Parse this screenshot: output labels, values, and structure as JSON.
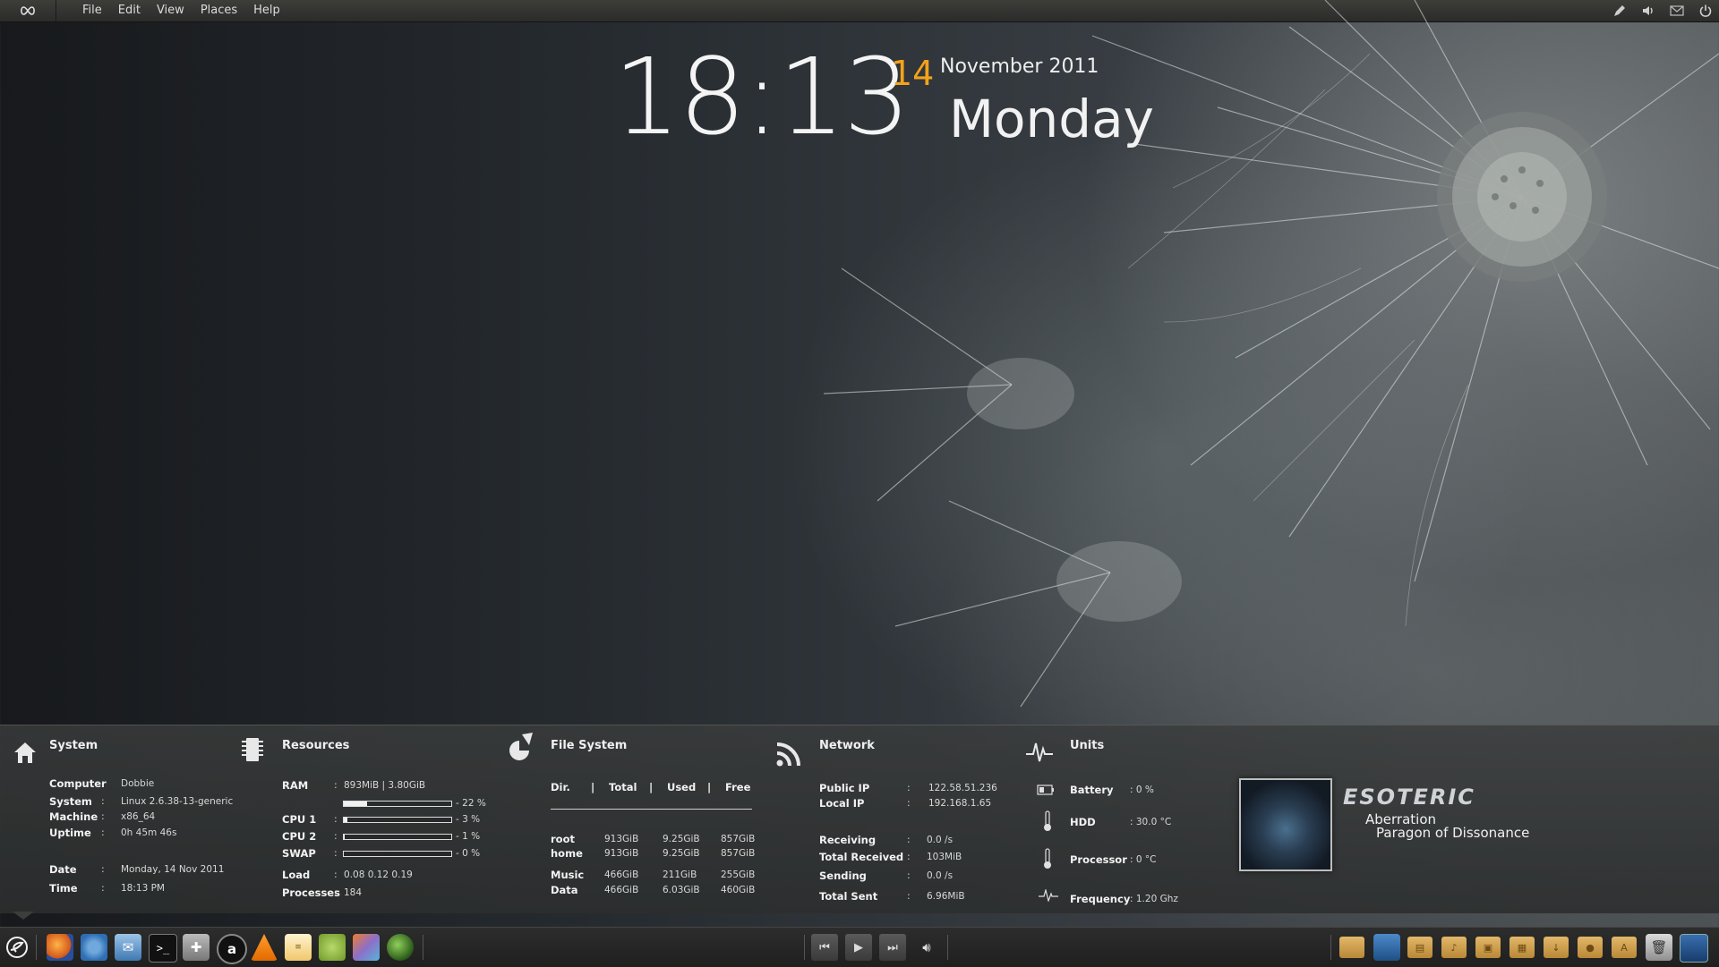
{
  "top_panel": {
    "logo_icon": "infinity-icon",
    "menu": [
      "File",
      "Edit",
      "View",
      "Places",
      "Help"
    ],
    "tray_icons": [
      "pen-icon",
      "volume-icon",
      "mail-icon",
      "power-icon"
    ]
  },
  "clock": {
    "time": "18:13",
    "day": "14",
    "month_year": "November 2011",
    "weekday": "Monday",
    "accent_color": "#f3a21b"
  },
  "conky": {
    "system": {
      "title": "System",
      "icon": "home-icon",
      "rows": [
        {
          "label": "Computer",
          "sep": ":",
          "value": "Dobbie"
        },
        {
          "label": "System",
          "sep": ":",
          "value": "Linux  2.6.38-13-generic"
        },
        {
          "label": "Machine",
          "sep": ":",
          "value": "x86_64"
        },
        {
          "label": "Uptime",
          "sep": ":",
          "value": "0h 45m 46s"
        },
        {
          "label": "Date",
          "sep": ":",
          "value": "Monday, 14 Nov 2011"
        },
        {
          "label": "Time",
          "sep": ":",
          "value": "18:13 PM"
        }
      ]
    },
    "resources": {
      "title": "Resources",
      "icon": "chip-icon",
      "ram_label": "RAM",
      "ram_value": "893MiB  |  3.80GiB",
      "ram_percent": "22 %",
      "ram_fraction": 0.22,
      "cpus": [
        {
          "label": "CPU 1",
          "percent": "3 %",
          "fraction": 0.03
        },
        {
          "label": "CPU 2",
          "percent": "1 %",
          "fraction": 0.01
        },
        {
          "label": "SWAP",
          "percent": "0 %",
          "fraction": 0.0
        }
      ],
      "load_label": "Load",
      "load_value": "0.08 0.12 0.19",
      "processes_label": "Processes",
      "processes_value": "184"
    },
    "filesystem": {
      "title": "File System",
      "icon": "pie-chart-icon",
      "headers": [
        "Dir.",
        "|",
        "Total",
        "|",
        "Used",
        "|",
        "Free"
      ],
      "rows": [
        {
          "dir": "root",
          "total": "913GiB",
          "used": "9.25GiB",
          "free": "857GiB"
        },
        {
          "dir": "home",
          "total": "913GiB",
          "used": "9.25GiB",
          "free": "857GiB"
        },
        {
          "dir": "Music",
          "total": "466GiB",
          "used": "211GiB",
          "free": "255GiB"
        },
        {
          "dir": "Data",
          "total": "466GiB",
          "used": "6.03GiB",
          "free": "460GiB"
        }
      ]
    },
    "network": {
      "title": "Network",
      "icon": "rss-icon",
      "rows": [
        {
          "label": "Public IP",
          "sep": ":",
          "value": "122.58.51.236"
        },
        {
          "label": "Local IP",
          "sep": ":",
          "value": "192.168.1.65"
        },
        {
          "label": "Receiving",
          "sep": ":",
          "value": "0.0 /s"
        },
        {
          "label": "Total Received",
          "sep": ":",
          "value": "103MiB"
        },
        {
          "label": "Sending",
          "sep": ":",
          "value": "0.0 /s"
        },
        {
          "label": "Total Sent",
          "sep": ":",
          "value": "6.96MiB"
        }
      ]
    },
    "units": {
      "title": "Units",
      "icon": "pulse-icon",
      "rows": [
        {
          "label": "Battery",
          "value": ": 0 %",
          "icon": "battery-icon"
        },
        {
          "label": "HDD",
          "value": ": 30.0 °C",
          "icon": "thermometer-icon"
        },
        {
          "label": "Processor",
          "value": ": 0 °C",
          "icon": "thermometer-icon"
        },
        {
          "label": "Frequency",
          "value": ": 1.20 Ghz",
          "icon": "pulse-icon"
        }
      ]
    },
    "music": {
      "artist": "ESOTERIC",
      "title": "Aberration",
      "album": "Paragon of Dissonance"
    }
  },
  "dock": {
    "launcher_icon": "elementary-logo-icon",
    "apps": [
      "firefox-icon",
      "chromium-icon",
      "mail-app-icon",
      "terminal-icon",
      "tools-icon",
      "amarok-icon",
      "vlc-icon",
      "text-editor-icon",
      "android-icon",
      "gimp-icon",
      "globe-icon"
    ],
    "media": [
      "previous-icon",
      "play-icon",
      "next-icon",
      "volume-icon"
    ],
    "places": [
      "home-folder-icon",
      "desktop-folder-icon",
      "documents-folder-icon",
      "music-folder-icon",
      "pictures-folder-icon",
      "videos-folder-icon",
      "downloads-folder-icon",
      "public-folder-icon",
      "templates-folder-icon",
      "trash-icon",
      "desktop-icon"
    ]
  }
}
